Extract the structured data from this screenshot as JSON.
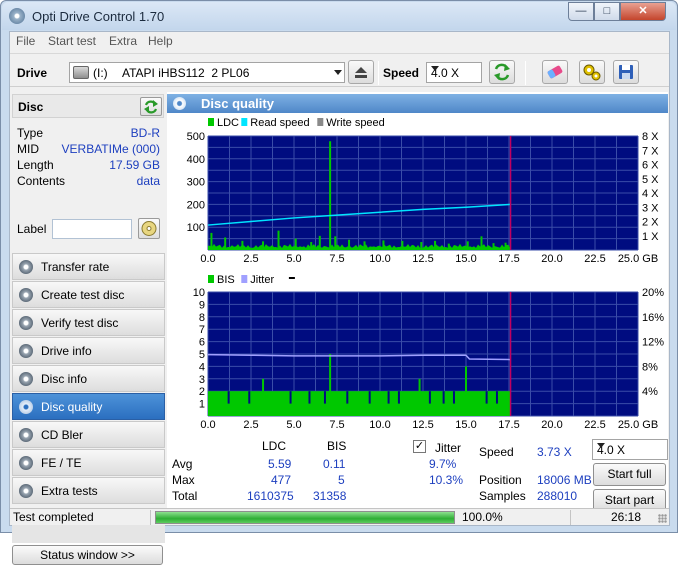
{
  "window": {
    "title": "Opti Drive Control 1.70"
  },
  "menu": {
    "items": [
      "File",
      "Start test",
      "Extra",
      "Help"
    ]
  },
  "toolbar": {
    "drive_label": "Drive",
    "drive_letter": "(I:)",
    "drive_value": "ATAPI iHBS112  2 PL06",
    "speed_label": "Speed",
    "speed_value": "4.0 X"
  },
  "disc": {
    "header": "Disc",
    "props": [
      {
        "key": "Type",
        "value": "BD-R"
      },
      {
        "key": "MID",
        "value": "VERBATIMe (000)"
      },
      {
        "key": "Length",
        "value": "17.59 GB"
      },
      {
        "key": "Contents",
        "value": "data"
      }
    ],
    "label_key": "Label",
    "label_value": ""
  },
  "nav": {
    "items": [
      {
        "label": "Transfer rate",
        "active": false
      },
      {
        "label": "Create test disc",
        "active": false
      },
      {
        "label": "Verify test disc",
        "active": false
      },
      {
        "label": "Drive info",
        "active": false
      },
      {
        "label": "Disc info",
        "active": false
      },
      {
        "label": "Disc quality",
        "active": true
      },
      {
        "label": "CD Bler",
        "active": false
      },
      {
        "label": "FE / TE",
        "active": false
      },
      {
        "label": "Extra tests",
        "active": false
      }
    ],
    "status_window": "Status window >>"
  },
  "panel": {
    "title": "Disc quality"
  },
  "colors": {
    "plot_bg": "#000c80",
    "grid": "#3a4da8",
    "ldc": "#00c800",
    "read_speed": "#00e5ff",
    "write_speed": "#8a8a8a",
    "bis": "#00c800",
    "jitter": "#a0a0ff",
    "marker": "#c00060"
  },
  "chart_data": [
    {
      "type": "area",
      "legend": [
        "LDC",
        "Read speed",
        "Write speed"
      ],
      "x_ticks": [
        "0.0",
        "2.5",
        "5.0",
        "7.5",
        "10.0",
        "12.5",
        "15.0",
        "17.5",
        "20.0",
        "22.5",
        "25.0 GB"
      ],
      "y_left_ticks": [
        "500",
        "400",
        "300",
        "200",
        "100"
      ],
      "y_right_ticks": [
        "8 X",
        "7 X",
        "6 X",
        "5 X",
        "4 X",
        "3 X",
        "2 X",
        "1 X"
      ],
      "xlim": [
        0,
        25
      ],
      "ylim": [
        0,
        500
      ],
      "y2lim": [
        0,
        8
      ],
      "end_marker": 17.59,
      "read_speed": {
        "x": [
          0,
          2.5,
          5,
          7.5,
          10,
          12.5,
          15,
          17.59
        ],
        "y": [
          1.75,
          2.0,
          2.25,
          2.45,
          2.65,
          2.85,
          3.0,
          3.2
        ]
      },
      "ldc_baseline": 18,
      "ldc_spikes": [
        {
          "x": 0.2,
          "y": 75
        },
        {
          "x": 1.0,
          "y": 55
        },
        {
          "x": 2.0,
          "y": 40
        },
        {
          "x": 3.2,
          "y": 38
        },
        {
          "x": 4.1,
          "y": 85
        },
        {
          "x": 5.1,
          "y": 50
        },
        {
          "x": 6.0,
          "y": 35
        },
        {
          "x": 6.5,
          "y": 62
        },
        {
          "x": 7.1,
          "y": 477
        },
        {
          "x": 7.4,
          "y": 60
        },
        {
          "x": 8.2,
          "y": 45
        },
        {
          "x": 9.1,
          "y": 38
        },
        {
          "x": 10.2,
          "y": 42
        },
        {
          "x": 11.3,
          "y": 40
        },
        {
          "x": 12.4,
          "y": 35
        },
        {
          "x": 13.2,
          "y": 40
        },
        {
          "x": 14.0,
          "y": 28
        },
        {
          "x": 15.1,
          "y": 38
        },
        {
          "x": 15.9,
          "y": 60
        },
        {
          "x": 16.6,
          "y": 30
        },
        {
          "x": 17.3,
          "y": 32
        }
      ]
    },
    {
      "type": "area",
      "legend": [
        "BIS",
        "Jitter"
      ],
      "x_ticks": [
        "0.0",
        "2.5",
        "5.0",
        "7.5",
        "10.0",
        "12.5",
        "15.0",
        "17.5",
        "20.0",
        "22.5",
        "25.0 GB"
      ],
      "y_left_ticks": [
        "10",
        "9",
        "8",
        "7",
        "6",
        "5",
        "4",
        "3",
        "2",
        "1"
      ],
      "y_right_ticks": [
        "20%",
        "16%",
        "12%",
        "8%",
        "4%"
      ],
      "xlim": [
        0,
        25
      ],
      "ylim": [
        0,
        10
      ],
      "y2lim": [
        0,
        20
      ],
      "end_marker": 17.59,
      "jitter": {
        "x": [
          0,
          2.5,
          5,
          7.5,
          10,
          12.5,
          15,
          15.2,
          17.59
        ],
        "y": [
          9.9,
          9.8,
          9.7,
          9.7,
          9.7,
          9.8,
          9.8,
          9.2,
          9.1
        ]
      },
      "bis_baseline": 2,
      "bis_spikes": [
        {
          "x": 3.2,
          "y": 3
        },
        {
          "x": 7.1,
          "y": 5
        },
        {
          "x": 15.0,
          "y": 4
        },
        {
          "x": 12.3,
          "y": 3
        }
      ],
      "bis_dips": [
        1.2,
        2.4,
        4.8,
        5.9,
        6.8,
        8.1,
        9.4,
        10.5,
        11.1,
        12.9,
        13.7,
        14.3,
        16.2,
        16.8
      ]
    }
  ],
  "stats": {
    "col_ldc": "LDC",
    "col_bis": "BIS",
    "jitter_label": "Jitter",
    "jitter_checked": true,
    "rows": [
      {
        "label": "Avg",
        "ldc": "5.59",
        "bis": "0.11",
        "jitter": "9.7%"
      },
      {
        "label": "Max",
        "ldc": "477",
        "bis": "5",
        "jitter": "10.3%"
      },
      {
        "label": "Total",
        "ldc": "1610375",
        "bis": "31358",
        "jitter": ""
      }
    ],
    "speed_label": "Speed",
    "speed_value": "3.73 X",
    "position_label": "Position",
    "position_value": "18006 MB",
    "samples_label": "Samples",
    "samples_value": "288010",
    "speed_select": "4.0 X",
    "start_full": "Start full",
    "start_part": "Start part"
  },
  "status": {
    "text": "Test completed",
    "progress": 100,
    "percent_text": "100.0%",
    "time": "26:18"
  }
}
